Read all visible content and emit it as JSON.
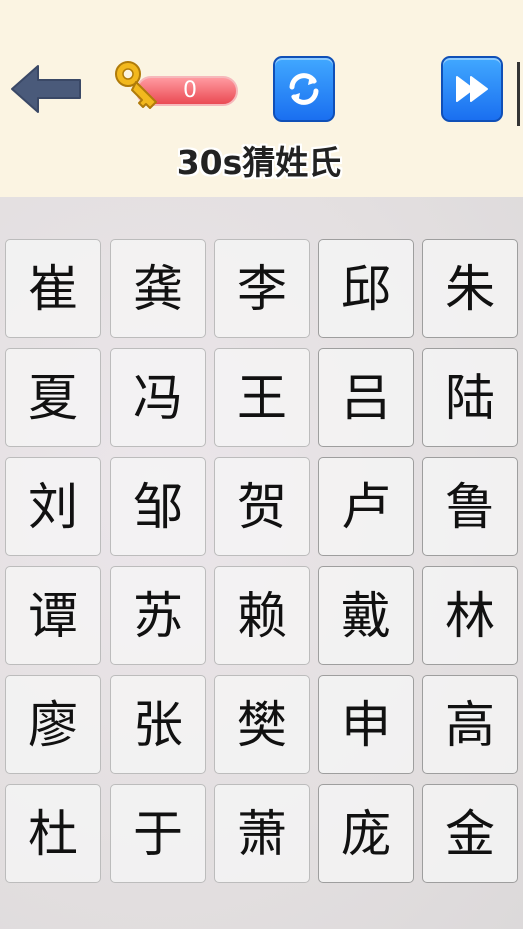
{
  "header": {
    "key_count": "0",
    "title": "30s猜姓氏"
  },
  "colors": {
    "header_bg": "#fbf4e2",
    "button_blue": "#1f7cf2",
    "key_bar_red": "#ea4a53",
    "back_arrow": "#4a5a7a"
  },
  "icons": {
    "back": "left-arrow-icon",
    "key": "key-icon",
    "refresh": "refresh-icon",
    "skip": "fast-forward-icon"
  },
  "grid": {
    "rows": [
      [
        "崔",
        "龚",
        "李",
        "邱",
        "朱"
      ],
      [
        "夏",
        "冯",
        "王",
        "吕",
        "陆"
      ],
      [
        "刘",
        "邹",
        "贺",
        "卢",
        "鲁"
      ],
      [
        "谭",
        "苏",
        "赖",
        "戴",
        "林"
      ],
      [
        "廖",
        "张",
        "樊",
        "申",
        "高"
      ],
      [
        "杜",
        "于",
        "萧",
        "庞",
        "金"
      ]
    ]
  }
}
